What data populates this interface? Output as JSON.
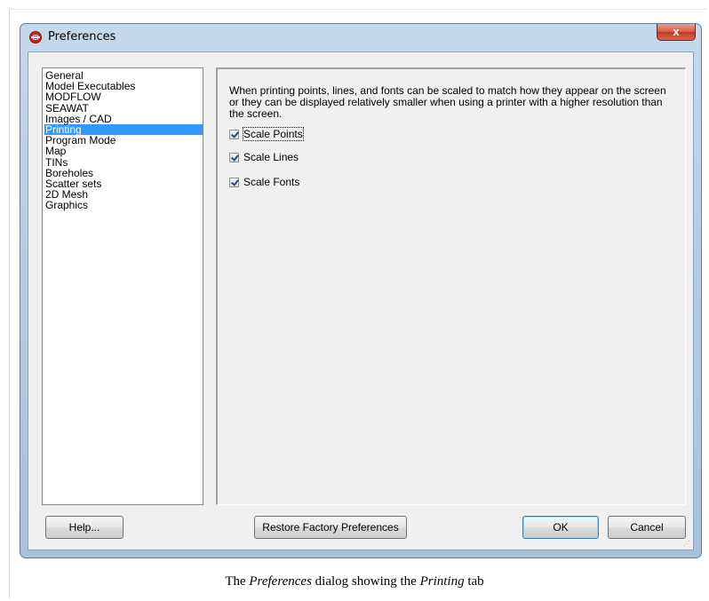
{
  "window": {
    "title": "Preferences",
    "close_label": "x"
  },
  "sidebar": {
    "items": [
      {
        "label": "General",
        "selected": false
      },
      {
        "label": "Model Executables",
        "selected": false
      },
      {
        "label": "MODFLOW",
        "selected": false
      },
      {
        "label": "SEAWAT",
        "selected": false
      },
      {
        "label": "Images / CAD",
        "selected": false
      },
      {
        "label": "Printing",
        "selected": true
      },
      {
        "label": "Program Mode",
        "selected": false
      },
      {
        "label": "Map",
        "selected": false
      },
      {
        "label": "TINs",
        "selected": false
      },
      {
        "label": "Boreholes",
        "selected": false
      },
      {
        "label": "Scatter sets",
        "selected": false
      },
      {
        "label": "2D Mesh",
        "selected": false
      },
      {
        "label": "Graphics",
        "selected": false
      }
    ]
  },
  "printing": {
    "description": "When printing points, lines, and fonts can be scaled to match how they appear on the screen or they can be displayed relatively smaller when using a printer with a higher resolution than the screen.",
    "options": [
      {
        "label": "Scale Points",
        "checked": true
      },
      {
        "label": "Scale Lines",
        "checked": true
      },
      {
        "label": "Scale Fonts",
        "checked": true
      }
    ]
  },
  "buttons": {
    "help": "Help...",
    "restore": "Restore Factory Preferences",
    "ok": "OK",
    "cancel": "Cancel"
  },
  "caption": {
    "prefix": "The ",
    "dialog": "Preferences",
    "middle": " dialog showing the ",
    "tab": "Printing",
    "suffix": " tab"
  },
  "colors": {
    "selection": "#3399ff",
    "close_button": "#c0391f"
  }
}
